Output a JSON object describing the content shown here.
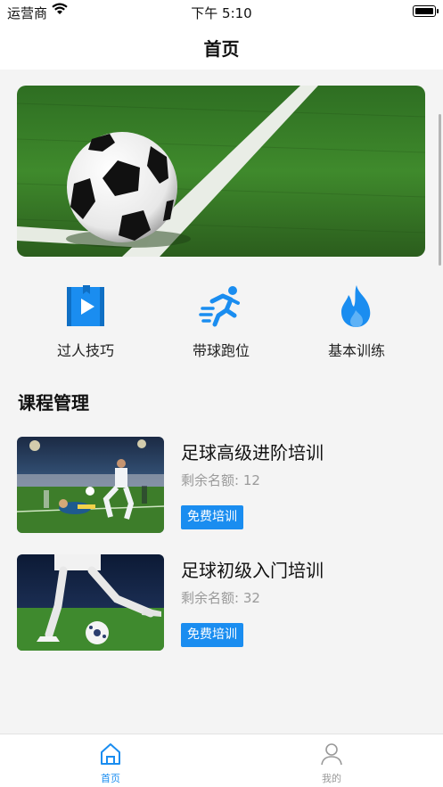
{
  "status_bar": {
    "carrier": "运营商",
    "time": "下午 5:10"
  },
  "nav": {
    "title": "首页"
  },
  "banner": {
    "image": "soccer-ball-on-field"
  },
  "categories": [
    {
      "label": "过人技巧",
      "icon": "video-book-icon"
    },
    {
      "label": "带球跑位",
      "icon": "running-icon"
    },
    {
      "label": "基本训练",
      "icon": "flame-icon"
    }
  ],
  "section": {
    "title": "课程管理"
  },
  "courses": [
    {
      "name": "足球高级进阶培训",
      "remaining": "剩余名额: 12",
      "tag": "免费培训",
      "image": "players-in-stadium"
    },
    {
      "name": "足球初级入门培训",
      "remaining": "剩余名额: 32",
      "tag": "免费培训",
      "image": "player-kicking-ball"
    }
  ],
  "tabbar": {
    "tabs": [
      {
        "label": "首页",
        "icon": "home-icon",
        "active": true
      },
      {
        "label": "我的",
        "icon": "person-icon",
        "active": false
      }
    ]
  },
  "colors": {
    "accent": "#1a8df0",
    "inactive": "#999999"
  }
}
